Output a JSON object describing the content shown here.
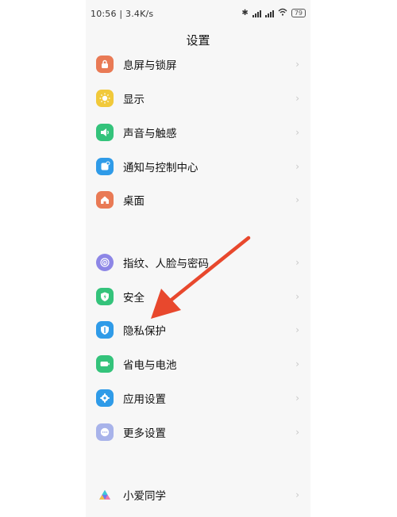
{
  "status_bar": {
    "time_info": "10:56 | 3.4K/s",
    "battery": "79"
  },
  "header": {
    "title": "设置"
  },
  "items": [
    {
      "label": "息屏与锁屏",
      "icon": "lock-icon",
      "color": "#e97a55"
    },
    {
      "label": "显示",
      "icon": "sun-icon",
      "color": "#f1c93a"
    },
    {
      "label": "声音与触感",
      "icon": "speaker-icon",
      "color": "#34c37b"
    },
    {
      "label": "通知与控制中心",
      "icon": "notification-icon",
      "color": "#2f9be8"
    },
    {
      "label": "桌面",
      "icon": "home-icon",
      "color": "#e97a55"
    },
    {
      "label": "指纹、人脸与密码",
      "icon": "fingerprint-icon",
      "color": "#8d86e6"
    },
    {
      "label": "安全",
      "icon": "shield-icon",
      "color": "#34c37b"
    },
    {
      "label": "隐私保护",
      "icon": "privacy-icon",
      "color": "#2f9be8"
    },
    {
      "label": "省电与电池",
      "icon": "battery-icon",
      "color": "#34c37b"
    },
    {
      "label": "应用设置",
      "icon": "gear-icon",
      "color": "#2f9be8"
    },
    {
      "label": "更多设置",
      "icon": "more-icon",
      "color": "#a8b3ea"
    },
    {
      "label": "小爱同学",
      "icon": "xiaoai-icon",
      "color": "#6b7cf0"
    }
  ],
  "annotation": {
    "arrow_color": "#e8482d"
  }
}
